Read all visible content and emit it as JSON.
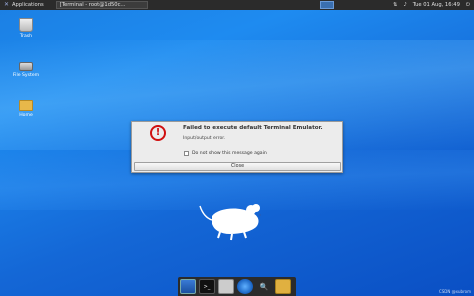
{
  "top_panel": {
    "applications_label": "Applications",
    "task_label": "[Terminal - root@1d50c...",
    "datetime": "Tue 01 Aug, 16:49",
    "icons": [
      "network-icon",
      "notification-icon",
      "power-icon"
    ]
  },
  "desktop": {
    "icons": [
      {
        "label": "Trash",
        "icon": "trash-icon"
      },
      {
        "label": "File System",
        "icon": "drive-icon"
      },
      {
        "label": "Home",
        "icon": "home-folder-icon"
      }
    ]
  },
  "dialog": {
    "title": "Failed to execute default Terminal Emulator.",
    "message": "Input/output error.",
    "checkbox_label": "Do not show this message again",
    "checkbox_checked": false,
    "close_label": "Close",
    "icon": "error-icon",
    "icon_color": "#d01010"
  },
  "dock": {
    "items": [
      "show-desktop-icon",
      "terminal-icon",
      "file-manager-icon",
      "web-browser-icon",
      "app-finder-icon",
      "folder-icon"
    ]
  },
  "watermark": "CSDN @xubrom",
  "colors": {
    "accent": "#1e8bf0",
    "panel": "#2b2b2b"
  }
}
